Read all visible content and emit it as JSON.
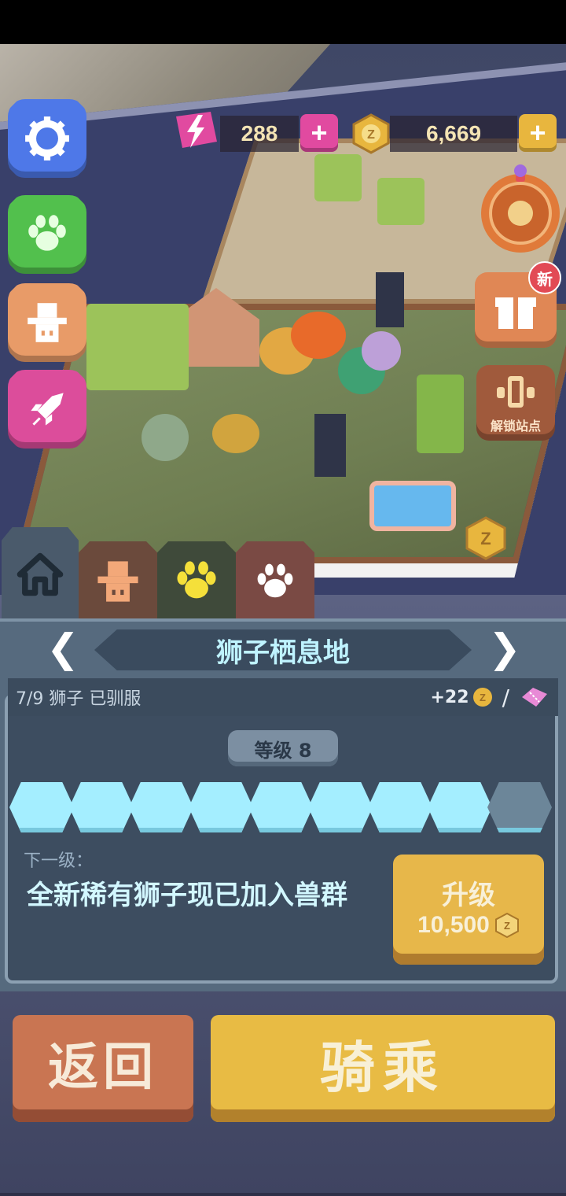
{
  "currency": {
    "energy_value": "288",
    "coin_value": "6,669"
  },
  "side": {
    "new_badge": "新",
    "unlock_label": "解锁站点"
  },
  "panel": {
    "title": "狮子栖息地",
    "tamed_text": "7/9 狮子 已驯服",
    "bonus_text": "+22",
    "level_text": "等级 8",
    "progress": {
      "filled": 8,
      "total": 9
    },
    "next_label": "下一级：",
    "next_text": "全新稀有狮子现已加入兽群",
    "upgrade_label": "升级",
    "upgrade_cost": "10,500"
  },
  "buttons": {
    "back_label": "返回",
    "ride_label": "骑乘"
  },
  "colors": {
    "energy": "#e14aa0",
    "coin": "#e8b63e",
    "panel": "#566a7e",
    "progress_fill": "#a4eeff"
  },
  "icons": [
    "settings-gear-icon",
    "paw-icon",
    "ranger-hat-icon",
    "rocket-icon",
    "energy-bolt-icon",
    "coin-icon",
    "prize-wheel-icon",
    "gift-icon",
    "unlock-station-icon",
    "home-icon",
    "ticket-icon"
  ]
}
